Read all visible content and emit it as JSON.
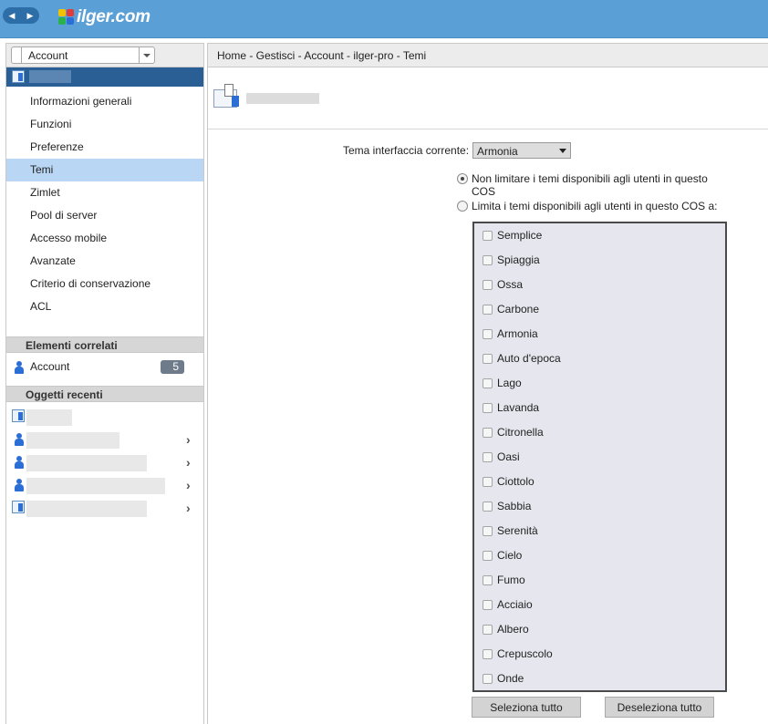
{
  "topbar": {
    "logo_text": "ilger.com",
    "back_glyph": "◀",
    "forward_glyph": "▶"
  },
  "sidebar": {
    "account_select": "Account",
    "nav_items": [
      {
        "label": "Informazioni generali"
      },
      {
        "label": "Funzioni"
      },
      {
        "label": "Preferenze"
      },
      {
        "label": "Temi",
        "active": true
      },
      {
        "label": "Zimlet"
      },
      {
        "label": "Pool di server"
      },
      {
        "label": "Accesso mobile"
      },
      {
        "label": "Avanzate"
      },
      {
        "label": "Criterio di conservazione"
      },
      {
        "label": "ACL"
      }
    ],
    "related_header": "Elementi correlati",
    "related": {
      "label": "Account",
      "count": "5"
    },
    "recent_header": "Oggetti recenti"
  },
  "main": {
    "breadcrumb": "Home - Gestisci - Account - ilger-pro - Temi",
    "current_theme_label": "Tema interfaccia corrente:",
    "current_theme_value": "Armonia",
    "radio_unlimited": "Non limitare i temi disponibili agli utenti in questo COS",
    "radio_unlimited_checked": true,
    "radio_limited": "Limita i temi disponibili agli utenti in questo COS a:",
    "themes": [
      "Semplice",
      "Spiaggia",
      "Ossa",
      "Carbone",
      "Armonia",
      "Auto d'epoca",
      "Lago",
      "Lavanda",
      "Citronella",
      "Oasi",
      "Ciottolo",
      "Sabbia",
      "Serenità",
      "Cielo",
      "Fumo",
      "Acciaio",
      "Albero",
      "Crepuscolo",
      "Onde"
    ],
    "select_all": "Seleziona tutto",
    "deselect_all": "Deseleziona tutto"
  },
  "colors": {
    "topbar": "#5aa0d6",
    "selected_nav": "#b9d7f5",
    "account_header": "#2a5f95"
  }
}
